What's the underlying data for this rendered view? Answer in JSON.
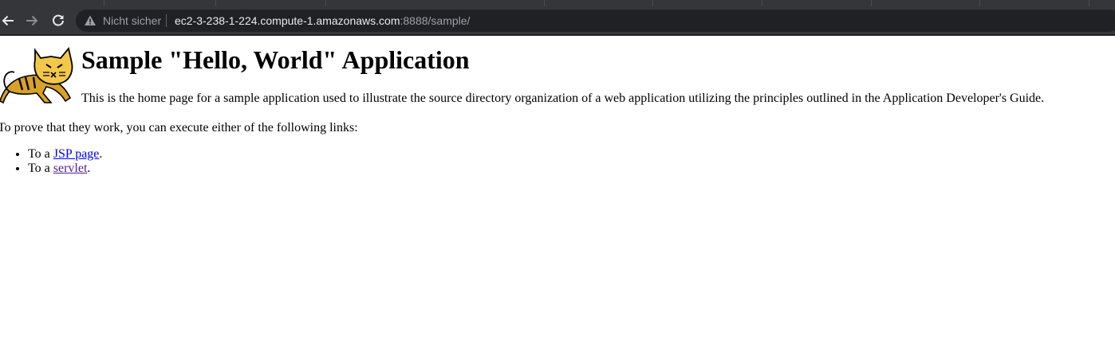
{
  "browser": {
    "security_label": "Nicht sicher",
    "url_host": "ec2-3-238-1-224.compute-1.amazonaws.com",
    "url_rest": ":8888/sample/",
    "theme": {
      "frame": "#35363a",
      "omnibox": "#202124",
      "text": "#e8eaed",
      "muted": "#9aa0a6"
    }
  },
  "page": {
    "logo_icon": "tomcat-logo-icon",
    "title": "Sample \"Hello, World\" Application",
    "intro": "This is the home page for a sample application used to illustrate the source directory organization of a web application utilizing the principles outlined in the Application Developer's Guide.",
    "prove_text": "To prove that they work, you can execute either of the following links:",
    "links": [
      {
        "prefix": "To a ",
        "link_text": "JSP page",
        "suffix": ".",
        "state": "unvisited"
      },
      {
        "prefix": "To a ",
        "link_text": "servlet",
        "suffix": ".",
        "state": "visited"
      }
    ],
    "colors": {
      "link": "#0000ee",
      "visited_link": "#551a8b"
    }
  }
}
